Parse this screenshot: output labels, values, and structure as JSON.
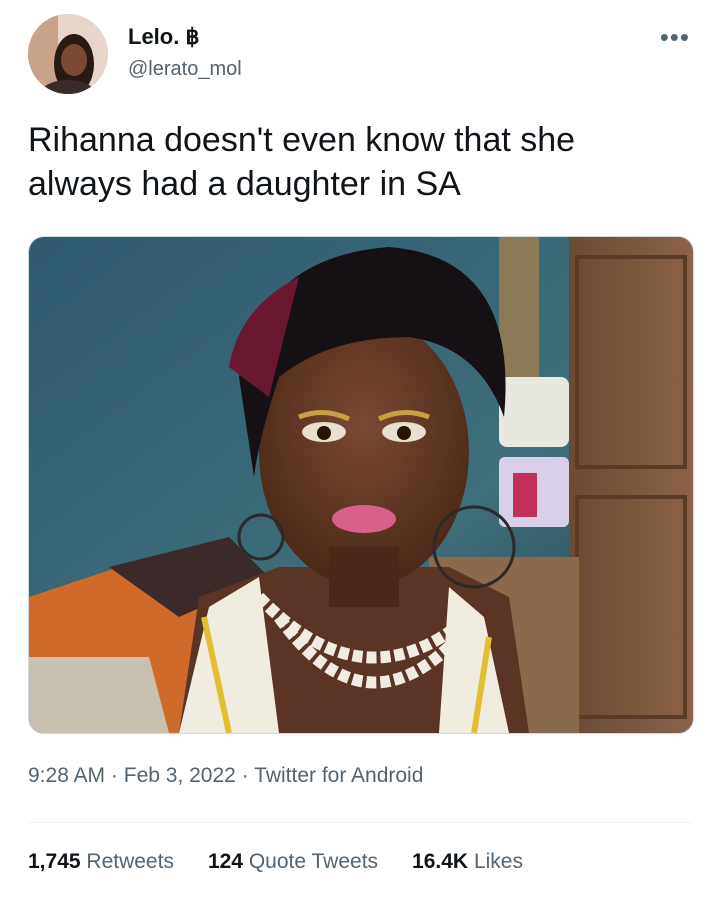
{
  "author": {
    "display_name": "Lelo. ฿",
    "handle": "@lerato_mol"
  },
  "tweet": {
    "text": "Rihanna doesn't even know that she always had a daughter in SA",
    "time": "9:28 AM",
    "date": "Feb 3, 2022",
    "source": "Twitter for Android",
    "separator": "·"
  },
  "stats": {
    "retweets_count": "1,745",
    "retweets_label": "Retweets",
    "quotes_count": "124",
    "quotes_label": "Quote Tweets",
    "likes_count": "16.4K",
    "likes_label": "Likes"
  },
  "icons": {
    "more": "more-options-icon"
  },
  "colors": {
    "text_primary": "#0f1419",
    "text_secondary": "#536471",
    "divider": "#eff3f4"
  }
}
